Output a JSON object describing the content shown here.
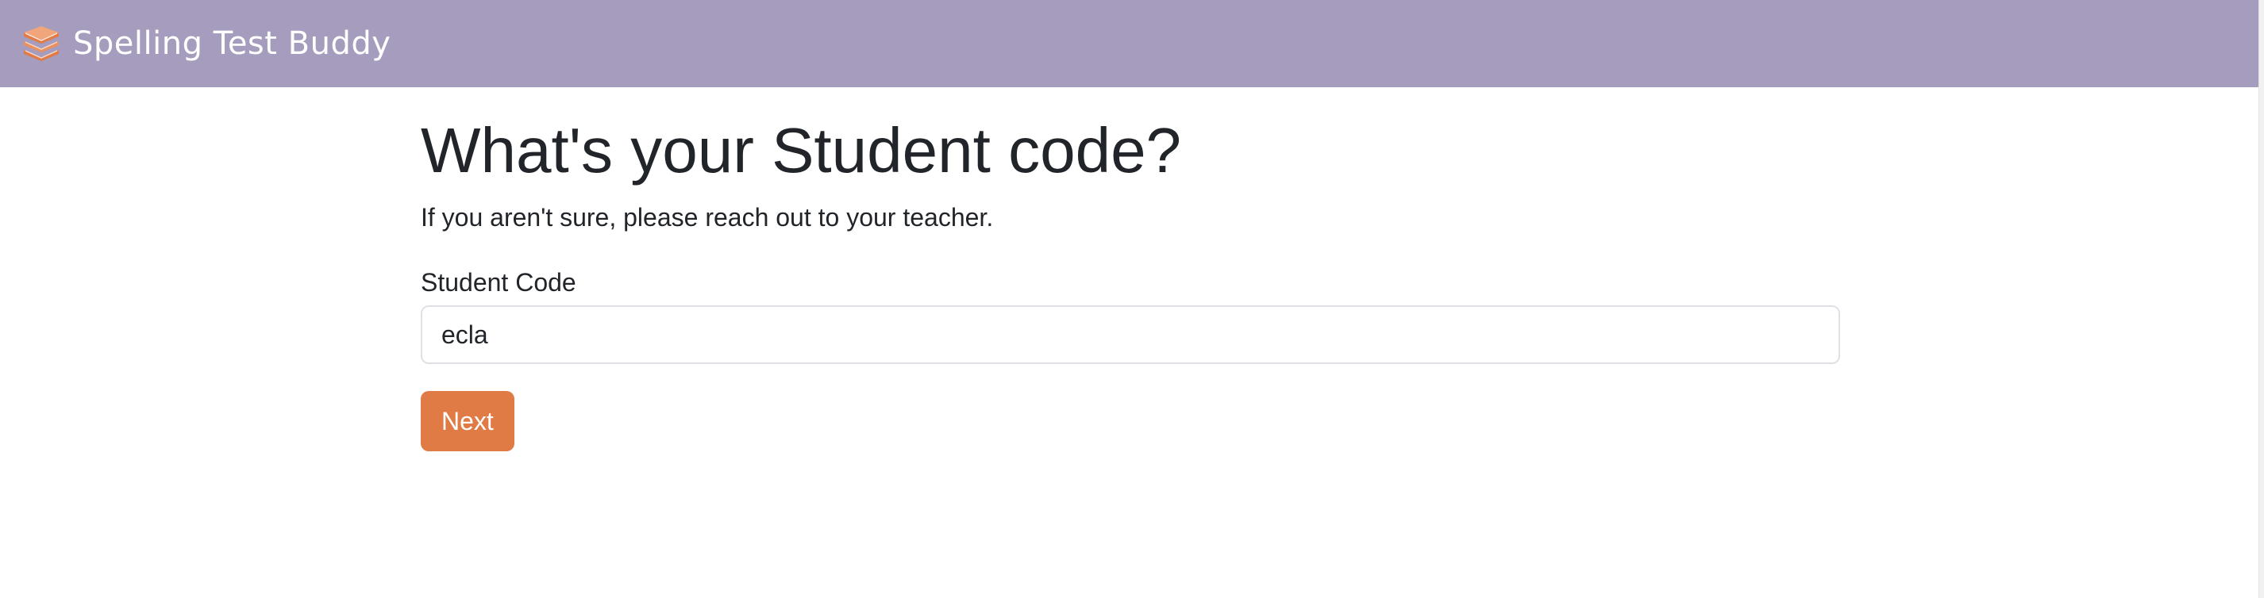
{
  "navbar": {
    "brand_icon": "books-stack-icon",
    "brand_title": "Spelling Test Buddy",
    "background_color": "#a69cbd"
  },
  "main": {
    "heading": "What's your Student code?",
    "subtitle": "If you aren't sure, please reach out to your teacher.",
    "field_label": "Student Code",
    "field_value": "ecla",
    "next_label": "Next",
    "accent_color": "#e07b45"
  }
}
